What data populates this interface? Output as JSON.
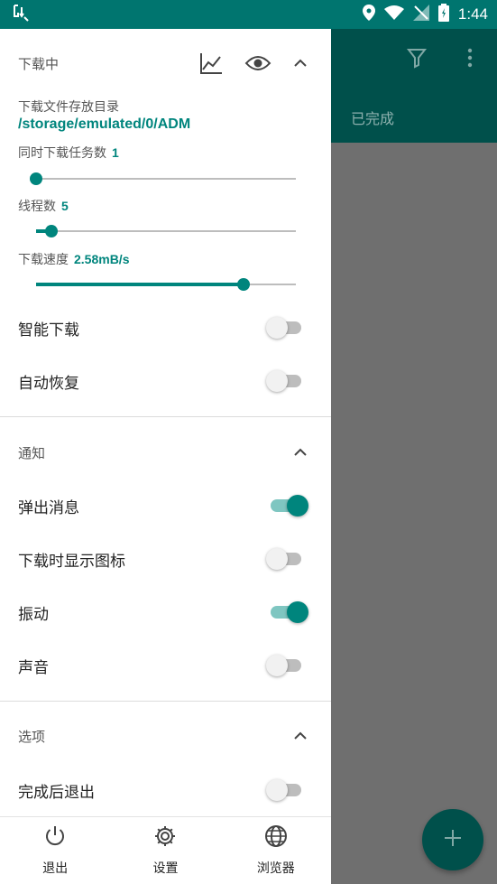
{
  "status_bar": {
    "time": "1:44"
  },
  "background": {
    "tab_label": "已完成"
  },
  "drawer": {
    "downloading": {
      "title": "下载中",
      "dir_label": "下载文件存放目录",
      "dir_path": "/storage/emulated/0/ADM",
      "concurrent_label": "同时下载任务数",
      "concurrent_value": "1",
      "concurrent_fraction": 0.0,
      "threads_label": "线程数",
      "threads_value": "5",
      "threads_fraction": 0.06,
      "speed_label": "下载速度",
      "speed_value": "2.58mB/s",
      "speed_fraction": 0.8,
      "smart_download_label": "智能下载",
      "smart_download_on": false,
      "auto_resume_label": "自动恢复",
      "auto_resume_on": false
    },
    "notifications": {
      "title": "通知",
      "popup_label": "弹出消息",
      "popup_on": true,
      "show_icon_label": "下载时显示图标",
      "show_icon_on": false,
      "vibrate_label": "振动",
      "vibrate_on": true,
      "sound_label": "声音",
      "sound_on": false
    },
    "options": {
      "title": "选项",
      "exit_after_label": "完成后退出",
      "exit_after_on": false
    },
    "bottom_nav": {
      "exit_label": "退出",
      "settings_label": "设置",
      "browser_label": "浏览器"
    }
  },
  "colors": {
    "accent": "#00857d",
    "toolbar": "#00504b",
    "statusbar": "#00756f"
  }
}
